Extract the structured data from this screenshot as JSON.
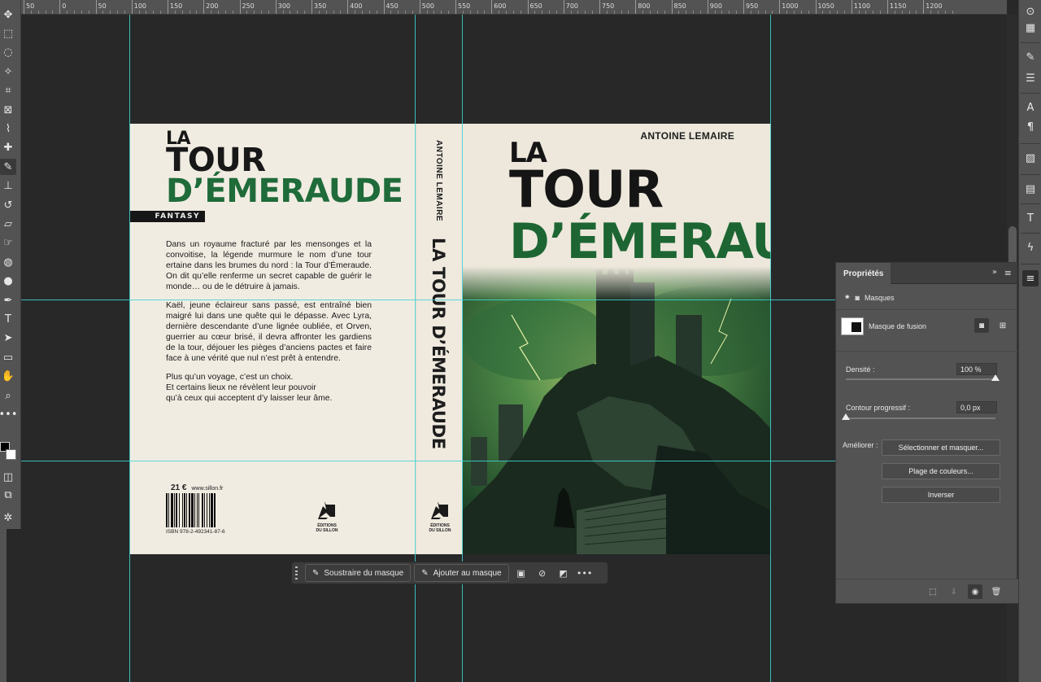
{
  "ruler": {
    "labels": [
      "50",
      "0",
      "50",
      "100",
      "150",
      "200",
      "250",
      "300",
      "350",
      "400",
      "450",
      "500",
      "550",
      "600",
      "650",
      "700",
      "750",
      "800",
      "850",
      "900",
      "950",
      "1000",
      "1050",
      "1100",
      "1150",
      "1200"
    ]
  },
  "toolbar": {
    "tools": [
      "move-icon",
      "marquee-icon",
      "lasso-icon",
      "magic-wand-icon",
      "crop-icon",
      "frame-icon",
      "eyedropper-icon",
      "healing-brush-icon",
      "brush-icon",
      "clone-stamp-icon",
      "history-brush-icon",
      "eraser-icon",
      "smudge-icon",
      "blur-icon",
      "dodge-icon",
      "pen-icon",
      "type-icon",
      "path-selection-icon",
      "rectangle-icon",
      "hand-icon",
      "zoom-icon",
      "more-tools-icon"
    ],
    "active_tool": "brush-icon",
    "foreground_color": "#000000",
    "background_color": "#ffffff"
  },
  "back_cover": {
    "title_line1": "LA",
    "title_line2": "TOUR",
    "title_line3": "D’ÉMERAUDE",
    "genre": "FANTASY",
    "paragraphs": [
      "Dans un royaume fracturé par les mensonges et la convoitise, la légende murmure le nom d’une tour ertaine dans les brumes du nord : la Tour d’Émeraude. On dit qu’elle renferme un secret capable de guérir le monde… ou de le détruire à jamais.",
      "Kaël, jeune éclaireur sans passé, est entraîné bien maigré lui dans une quête qui le dépasse. Avec Lyra, dernière descendante d’une lignée oubliée, et Orven, guerrier au cœur brisé, il devra affronter les gardiens de la tour, déjouer les pièges d’anciens pactes et faire face à une vérité que nul n’est prêt à entendre."
    ],
    "closing": [
      "Plus qu’un voyage, c’est un choix.",
      "Et certains lieux ne révèlent leur pouvoir",
      "qu’à ceux qui acceptent d’y laisser leur âme."
    ],
    "price": "21 €",
    "website": "www.sillon.fr",
    "isbn": "ISBN 978-2-492341-87-6",
    "publisher_line1": "ÉDITIONS",
    "publisher_line2": "DU SILLON"
  },
  "spine": {
    "author": "ANTOINE LEMAIRE",
    "title": "LA TOUR D’ÉMERAUDE",
    "publisher_line1": "ÉDITIONS",
    "publisher_line2": "DU SILLON"
  },
  "front_cover": {
    "author": "ANTOINE LEMAIRE",
    "title_line1": "LA",
    "title_line2": "TOUR",
    "title_line3": "D’ÉMERAUDE",
    "accent_color": "#1d6633"
  },
  "taskbar": {
    "subtract": "Soustraire du masque",
    "add": "Ajouter au masque"
  },
  "properties": {
    "tab": "Propriétés",
    "section": "Masques",
    "mask_name": "Masque de fusion",
    "density_label": "Densité :",
    "density_value": "100 %",
    "density_level": 1.0,
    "feather_label": "Contour progressif :",
    "feather_value": "0,0 px",
    "feather_level": 0.0,
    "refine_label": "Améliorer :",
    "btn_select_mask": "Sélectionner et masquer...",
    "btn_color_range": "Plage de couleurs...",
    "btn_invert": "Inverser"
  }
}
